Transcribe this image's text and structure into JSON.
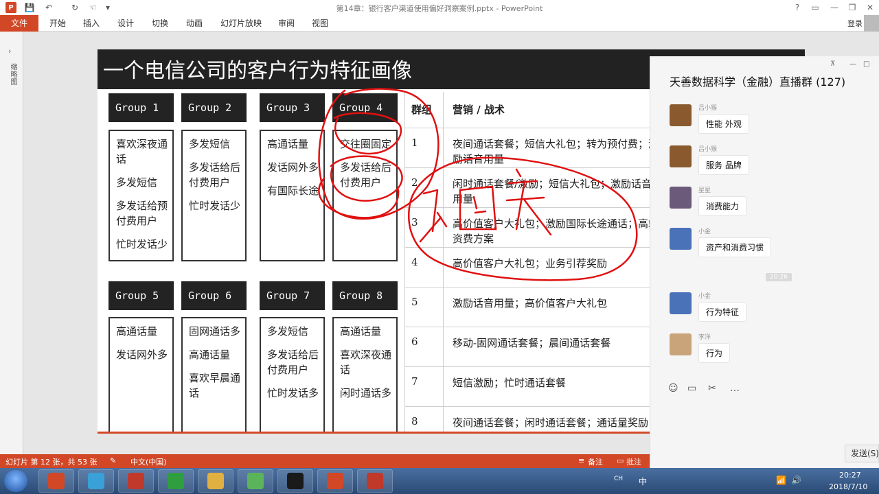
{
  "window": {
    "title": "第14章：银行客户渠道使用偏好洞察案例.pptx - PowerPoint",
    "help": "?",
    "minimize": "—",
    "restore": "❐",
    "close": "✕"
  },
  "quick_access": {
    "logo": "P",
    "save_icon": "💾",
    "undo_icon": "↶",
    "redo_icon": "↻",
    "touch_icon": "☜",
    "more_icon": "▾"
  },
  "ribbon": {
    "file": "文件",
    "tabs": [
      "开始",
      "插入",
      "设计",
      "切换",
      "动画",
      "幻灯片放映",
      "审阅",
      "视图"
    ],
    "login": "登录"
  },
  "thumbnail_pane": {
    "expand_arrow": "›",
    "label": "缩略图"
  },
  "slide": {
    "title": "一个电信公司的客户行为特征画像",
    "groups": [
      {
        "name": "Group 1",
        "items": [
          "喜欢深夜通话",
          "多发短信",
          "多发话给预付费用户",
          "忙时发话少"
        ]
      },
      {
        "name": "Group 2",
        "items": [
          "多发短信",
          "多发话给后付费用户",
          "忙时发话少"
        ]
      },
      {
        "name": "Group 3",
        "items": [
          "高通话量",
          "发话网外多",
          "有国际长途"
        ]
      },
      {
        "name": "Group 4",
        "items": [
          "交往圈固定",
          "多发话给后付费用户"
        ]
      },
      {
        "name": "Group 5",
        "items": [
          "高通话量",
          "发话网外多"
        ]
      },
      {
        "name": "Group 6",
        "items": [
          "固网通话多",
          "高通话量",
          "喜欢早晨通话"
        ]
      },
      {
        "name": "Group 7",
        "items": [
          "多发短信",
          "多发话给后付费用户",
          "忙时发话多"
        ]
      },
      {
        "name": "Group 8",
        "items": [
          "高通话量",
          "喜欢深夜通话",
          "闲时通话多"
        ]
      }
    ],
    "table": {
      "headers": [
        "群组",
        "营销 / 战术"
      ],
      "rows": [
        {
          "id": "1",
          "text": "夜间通话套餐；短信大礼包；转为预付费；激",
          "text2": "励话音用量"
        },
        {
          "id": "2",
          "text": "闲时通话套餐/激励；短信大礼包；激励话音",
          "text2": "用量"
        },
        {
          "id": "3",
          "text": "高价值客户大礼包；激励国际长途通话；高端",
          "text2": "资费方案"
        },
        {
          "id": "4",
          "text": "高价值客户大礼包；业务引荐奖励",
          "text2": ""
        },
        {
          "id": "5",
          "text": "激励话音用量；高价值客户大礼包",
          "text2": ""
        },
        {
          "id": "6",
          "text": "移动-固网通话套餐；晨间通话套餐",
          "text2": ""
        },
        {
          "id": "7",
          "text": "短信激励；忙时通话套餐",
          "text2": ""
        },
        {
          "id": "8",
          "text": "夜间通话套餐；闲时通话套餐；通话量奖励",
          "text2": ""
        }
      ]
    }
  },
  "status_bar": {
    "slide_info": "幻灯片 第 12 张，共 53 张",
    "language": "中文(中国)",
    "notes": "备注",
    "comments": "批注"
  },
  "chat": {
    "title": "天善数据科学（金融）直播群 (127)",
    "pin_icon": "⊼",
    "minimize_icon": "—",
    "maximize_icon": "□",
    "close_icon": "✕",
    "time_separator": "20:26",
    "messages": [
      {
        "sender": "吕小猴",
        "text": "性能 外观",
        "avatar_color": "#8a5a2e"
      },
      {
        "sender": "吕小猴",
        "text": "服务 品牌",
        "avatar_color": "#8a5a2e"
      },
      {
        "sender": "星星",
        "text": "消费能力",
        "avatar_color": "#6b5a7a"
      },
      {
        "sender": "小金",
        "text": "资产和消费习惯",
        "avatar_color": "#4a72b8"
      },
      {
        "sender": "小金",
        "text": "行为特征",
        "avatar_color": "#4a72b8"
      },
      {
        "sender": "李洋",
        "text": "行为",
        "avatar_color": "#c9a37a"
      }
    ],
    "toolbar": {
      "emoji": "☺",
      "folder": "▭",
      "scissors": "✂",
      "chat_bubble": "…"
    },
    "send_label": "发送(S)"
  },
  "taskbar": {
    "apps": [
      {
        "name": "app-1",
        "color": "#d24726"
      },
      {
        "name": "app-2",
        "color": "#3aa0d8"
      },
      {
        "name": "app-3",
        "color": "#c0392b"
      },
      {
        "name": "app-4",
        "color": "#2e9e3e"
      },
      {
        "name": "app-5",
        "color": "#e0b040"
      },
      {
        "name": "app-6",
        "color": "#5ab55a"
      },
      {
        "name": "app-7",
        "color": "#1a1a1a"
      },
      {
        "name": "app-8",
        "color": "#d24726"
      },
      {
        "name": "app-9",
        "color": "#c0392b"
      }
    ],
    "tray": {
      "lang": "CH",
      "ime": "中",
      "network": "📶",
      "volume": "🔊"
    },
    "clock_time": "20:27",
    "clock_date": "2018/7/10"
  }
}
